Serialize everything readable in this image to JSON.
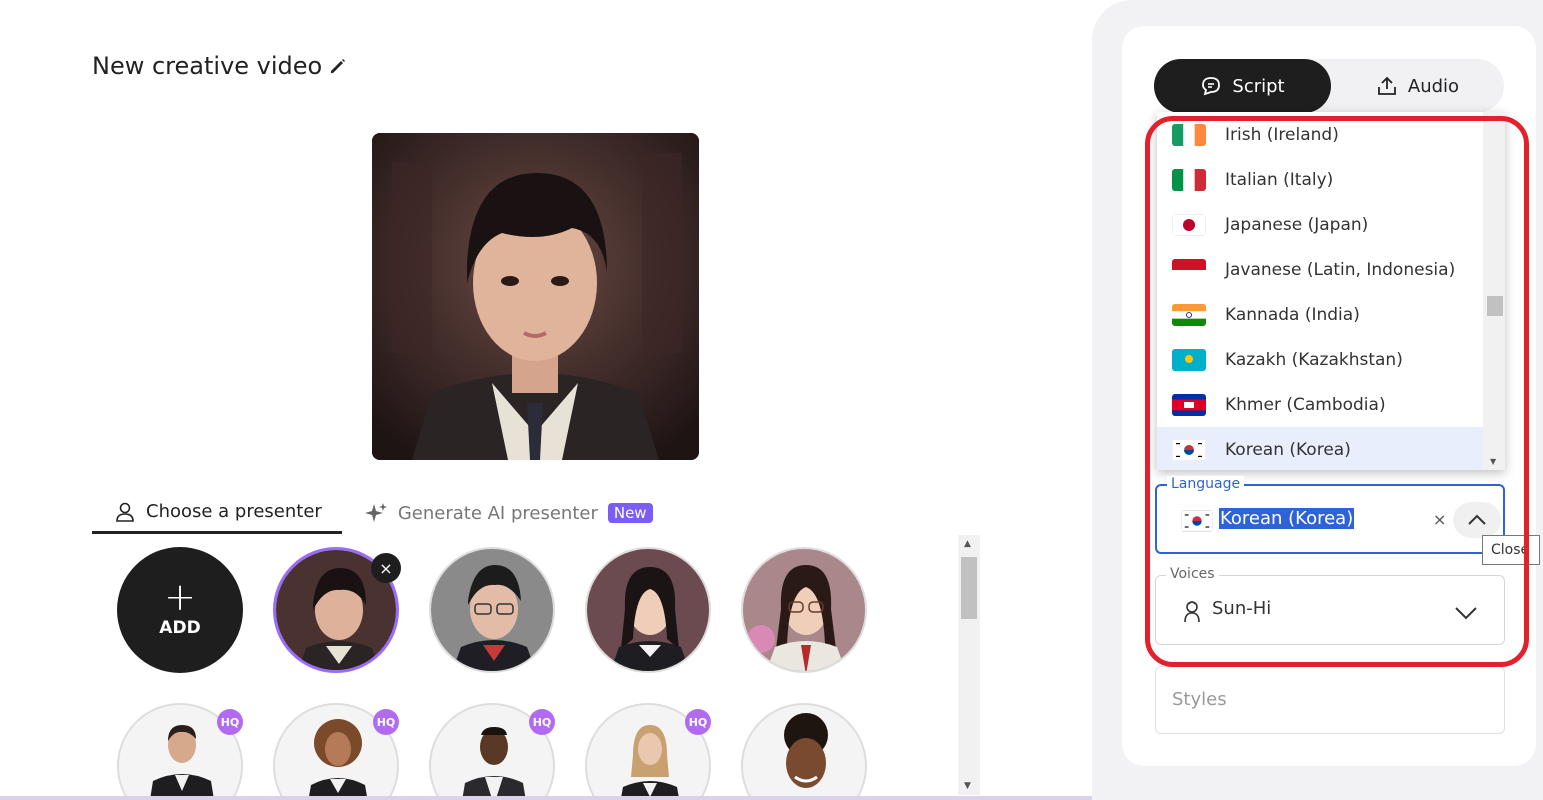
{
  "editor": {
    "title": "New creative video"
  },
  "presenter_tabs": {
    "choose_label": "Choose a presenter",
    "generate_label": "Generate AI presenter",
    "new_badge": "New"
  },
  "grid": {
    "add_label": "ADD",
    "hq_badge": "HQ",
    "remove_symbol": "×"
  },
  "right_panel": {
    "script_tab": "Script",
    "audio_tab": "Audio"
  },
  "language_list": {
    "items": [
      "Irish (Ireland)",
      "Italian (Italy)",
      "Japanese (Japan)",
      "Javanese (Latin, Indonesia)",
      "Kannada (India)",
      "Kazakh (Kazakhstan)",
      "Khmer (Cambodia)",
      "Korean (Korea)"
    ],
    "selected": "Korean (Korea)"
  },
  "language_field": {
    "label": "Language",
    "value": "Korean (Korea)",
    "clear_symbol": "×",
    "tooltip": "Close"
  },
  "voices_field": {
    "label": "Voices",
    "value": "Sun-Hi"
  },
  "styles_field": {
    "placeholder": "Styles"
  },
  "colors": {
    "accent_blue": "#2e63d8",
    "highlight_red": "#e3202b",
    "new_badge": "#7b5cf5",
    "hq_badge": "#b06bf0",
    "selected_ring": "#9a6bff"
  }
}
